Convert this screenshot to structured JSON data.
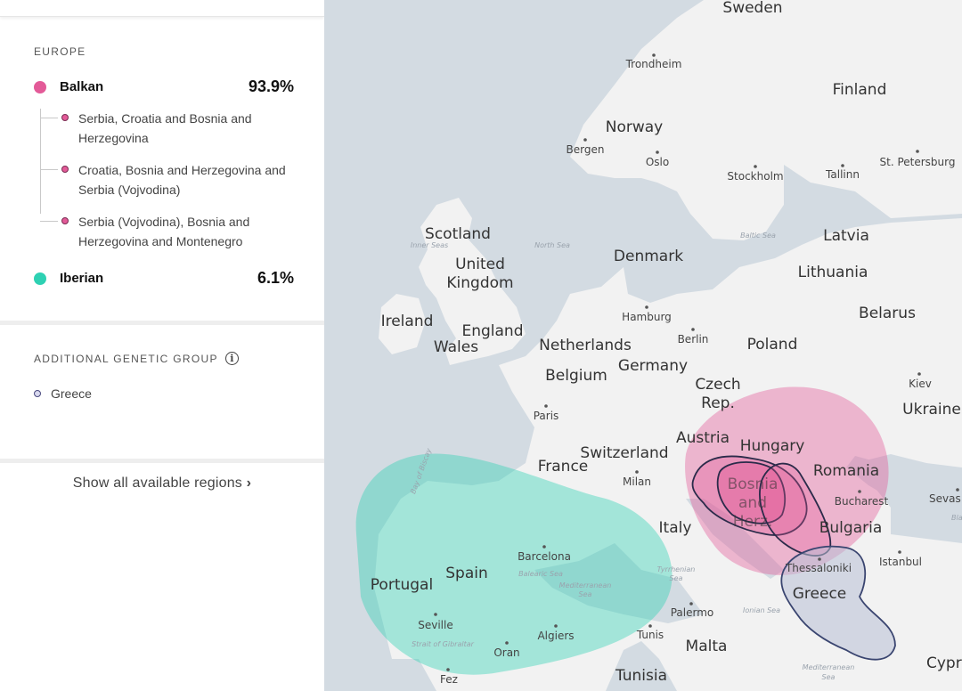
{
  "sidebar": {
    "europe_title": "EUROPE",
    "balkan": {
      "label": "Balkan",
      "percent": "93.9%",
      "color": "#e35a98",
      "subregions": [
        {
          "label": "Serbia, Croatia and Bosnia and Herzegovina"
        },
        {
          "label": "Croatia, Bosnia and Herzegovina and Serbia (Vojvodina)"
        },
        {
          "label": "Serbia (Vojvodina), Bosnia and Herzegovina and Montenegro"
        }
      ]
    },
    "iberian": {
      "label": "Iberian",
      "percent": "6.1%",
      "color": "#2ed1b3"
    },
    "additional_title": "ADDITIONAL GENETIC GROUP",
    "info_icon": "info-icon",
    "additional_items": [
      {
        "label": "Greece",
        "color": "#4a4a80"
      }
    ],
    "show_all": "Show all available regions",
    "show_all_icon": "chevron-right-icon"
  },
  "map": {
    "land_color": "#f2f2f2",
    "water_color": "#d3dbe2",
    "countries": {
      "sweden": "Sweden",
      "finland": "Finland",
      "norway": "Norway",
      "latvia": "Latvia",
      "lithuania": "Lithuania",
      "belarus": "Belarus",
      "denmark": "Denmark",
      "scotland": "Scotland",
      "uk_line1": "United",
      "uk_line2": "Kingdom",
      "ireland": "Ireland",
      "england": "England",
      "wales": "Wales",
      "netherlands": "Netherlands",
      "belgium": "Belgium",
      "germany": "Germany",
      "poland": "Poland",
      "czech_line1": "Czech",
      "czech_line2": "Rep.",
      "ukraine": "Ukraine",
      "austria": "Austria",
      "hungary": "Hungary",
      "romania": "Romania",
      "switzerland": "Switzerland",
      "france": "France",
      "bosnia_line1": "Bosnia",
      "bosnia_line2": "and",
      "bosnia_line3": "Herz.",
      "bulgaria": "Bulgaria",
      "italy": "Italy",
      "portugal": "Portugal",
      "spain": "Spain",
      "greece": "Greece",
      "malta": "Malta",
      "tunisia": "Tunisia",
      "cyprus": "Cypr"
    },
    "cities": {
      "trondheim": "Trondheim",
      "bergen": "Bergen",
      "oslo": "Oslo",
      "stockholm": "Stockholm",
      "tallinn": "Tallinn",
      "st_petersburg": "St. Petersburg",
      "hamburg": "Hamburg",
      "berlin": "Berlin",
      "kiev": "Kiev",
      "paris": "Paris",
      "milan": "Milan",
      "bucharest": "Bucharest",
      "sevastopol": "Sevas",
      "barcelona": "Barcelona",
      "thessaloniki": "Thessaloniki",
      "istanbul": "Istanbul",
      "seville": "Seville",
      "algiers": "Algiers",
      "oran": "Oran",
      "palermo": "Palermo",
      "tunis": "Tunis",
      "fez": "Fez"
    },
    "seas": {
      "inner_seas": "Inner Seas",
      "north_sea": "North Sea",
      "baltic_sea": "Baltic Sea",
      "bay_of_biscay": "Bay of Biscay",
      "balearic_sea": "Balearic Sea",
      "med_line1": "Mediterranean",
      "med_line2": "Sea",
      "tyrrhenian_line1": "Tyrrhenian",
      "tyrrhenian_line2": "Sea",
      "strait": "Strait of Gibraltar",
      "ionian": "Ionian Sea",
      "med2_line1": "Mediterranean",
      "med2_line2": "Sea",
      "black_sea": "Bla"
    }
  }
}
